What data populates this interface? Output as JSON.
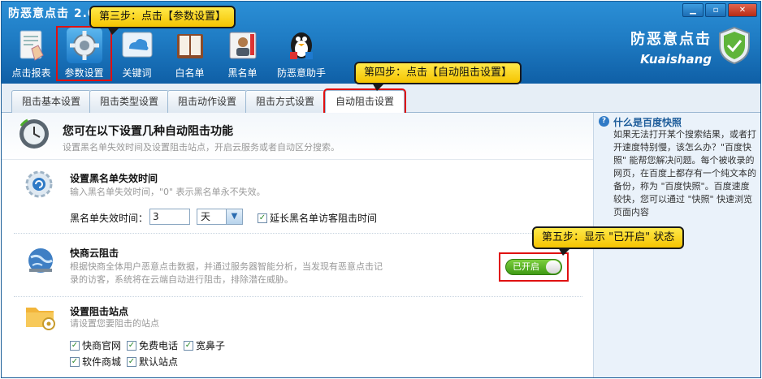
{
  "app": {
    "title": "防恶意点击 2.0"
  },
  "window_buttons": {
    "minimize": "▁",
    "maximize": "▫",
    "close": "✕"
  },
  "toolbar": [
    {
      "label": "点击报表",
      "icon": "report-icon"
    },
    {
      "label": "参数设置",
      "icon": "gear-icon"
    },
    {
      "label": "关键词",
      "icon": "cloud-icon"
    },
    {
      "label": "白名单",
      "icon": "book-icon"
    },
    {
      "label": "黑名单",
      "icon": "blacklist-icon"
    },
    {
      "label": "防恶意助手",
      "icon": "penguin-icon"
    }
  ],
  "brand": {
    "cn": "防恶意点击",
    "en": "Kuaishang"
  },
  "tabs": [
    "阻击基本设置",
    "阻击类型设置",
    "阻击动作设置",
    "阻击方式设置",
    "自动阻击设置"
  ],
  "main": {
    "title": "您可在以下设置几种自动阻击功能",
    "subtitle": "设置黑名单失效时间及设置阻击站点，开启云服务或者自动区分搜索。",
    "blacklist": {
      "title": "设置黑名单失效时间",
      "desc": "输入黑名单失效时间，\"0\" 表示黑名单永不失效。",
      "field_label": "黑名单失效时间：",
      "value": "3",
      "unit": "天",
      "extend_label": "延长黑名单访客阻击时间"
    },
    "cloud": {
      "title": "快商云阻击",
      "desc1": "根据快商全体用户恶意点击数据，并通过服务器智能分析，当发现有恶意点击记",
      "desc2": "录的访客，系统将在云端自动进行阻击，排除潜在威胁。",
      "toggle_label": "已开启"
    },
    "sites": {
      "title": "设置阻击站点",
      "desc": "请设置您要阻击的站点",
      "options": [
        "快商官网",
        "免费电话",
        "宽鼻子",
        "软件商城",
        "默认站点"
      ]
    }
  },
  "sidebar": {
    "title": "什么是百度快照",
    "text": "如果无法打开某个搜索结果，或者打开速度特别慢，该怎么办？\"百度快照\" 能帮您解决问题。每个被收录的网页，在百度上都存有一个纯文本的备份，称为 \"百度快照\"。百度速度较快，您可以通过 \"快照\" 快速浏览页面内容"
  },
  "callouts": {
    "step3": "第三步：点击【参数设置】",
    "step4": "第四步：点击【自动阻击设置】",
    "step5": "第五步：显示 \"已开启\" 状态"
  }
}
